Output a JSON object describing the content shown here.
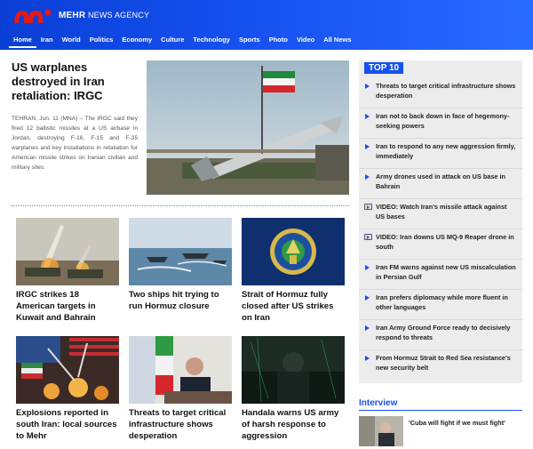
{
  "header": {
    "brand": "MEHR",
    "brand_suffix": "NEWS AGENCY",
    "nav": [
      "Home",
      "Iran",
      "World",
      "Politics",
      "Economy",
      "Culture",
      "Technology",
      "Sports",
      "Photo",
      "Video",
      "All News"
    ]
  },
  "main": {
    "headline": "US warplanes destroyed in Iran retaliation: IRGC",
    "lead": "TEHRAN, Jun. 11 (MNA) – The IRGC said they fired 12 ballistic missiles at a US airbase in Jordan, destroying F-16, F-15 and F-35 warplanes and key installations in retaliation for American missile strikes on Iranian civilian and military sites."
  },
  "grid": [
    {
      "title": "IRGC strikes 18 American targets in Kuwait and Bahrain"
    },
    {
      "title": "Two ships hit trying to run Hormuz closure"
    },
    {
      "title": "Strait of Hormuz fully closed after US strikes on Iran"
    },
    {
      "title": "Explosions reported in south Iran: local sources to Mehr"
    },
    {
      "title": "Threats to target critical infrastructure shows desperation"
    },
    {
      "title": "Handala warns US army of harsh response to aggression"
    }
  ],
  "sidebar": {
    "top10_label": "TOP 10",
    "items": [
      {
        "text": "Threats to target critical infrastructure shows desperation",
        "icon": "bullet"
      },
      {
        "text": "Iran not to back down in face of hegemony-seeking powers",
        "icon": "bullet"
      },
      {
        "text": "Iran to respond to any new aggression firmly, immediately",
        "icon": "bullet"
      },
      {
        "text": "Army drones used in attack on US base in Bahrain",
        "icon": "bullet"
      },
      {
        "text": "VIDEO: Watch Iran's missile attack against US bases",
        "icon": "video"
      },
      {
        "text": "VIDEO: Iran downs US MQ-9 Reaper drone in south",
        "icon": "video"
      },
      {
        "text": "Iran FM warns against new US miscalculation in Persian Gulf",
        "icon": "bullet"
      },
      {
        "text": "Iran prefers diplomacy while more fluent in other languages",
        "icon": "bullet"
      },
      {
        "text": "Iran Army Ground Force ready to decisively respond to threats",
        "icon": "bullet"
      },
      {
        "text": "From Hormuz Strait to Red Sea resistance's new security belt",
        "icon": "bullet"
      }
    ],
    "interview_label": "Interview",
    "interview_title": "'Cuba will fight if we must fight'"
  }
}
